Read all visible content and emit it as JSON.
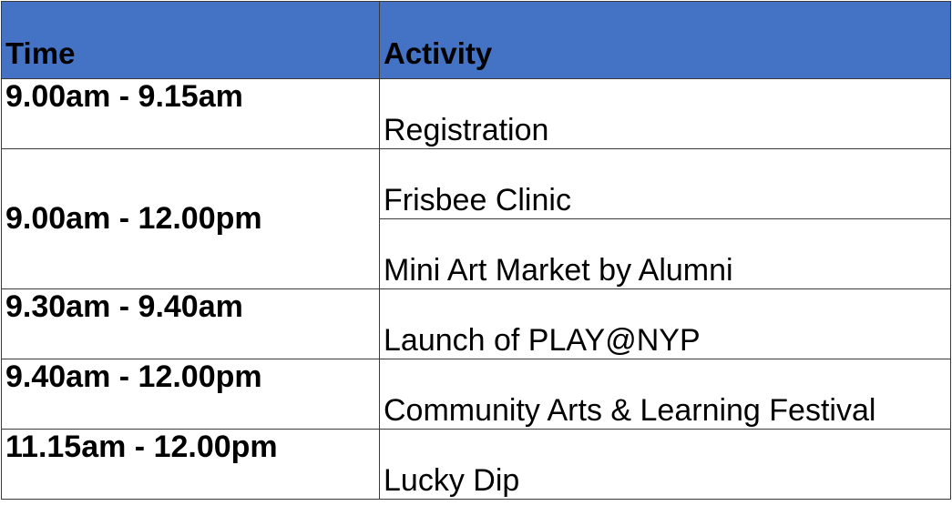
{
  "table": {
    "headers": {
      "time": "Time",
      "activity": "Activity"
    },
    "rows": [
      {
        "time": "9.00am - 9.15am",
        "activities": [
          "Registration"
        ]
      },
      {
        "time": "9.00am - 12.00pm",
        "activities": [
          "Frisbee Clinic",
          "Mini Art Market by Alumni"
        ]
      },
      {
        "time": "9.30am - 9.40am",
        "activities": [
          "Launch of PLAY@NYP"
        ]
      },
      {
        "time": "9.40am - 12.00pm",
        "activities": [
          "Community Arts & Learning Festival"
        ]
      },
      {
        "time": "11.15am - 12.00pm",
        "activities": [
          "Lucky Dip"
        ]
      }
    ]
  },
  "colors": {
    "header_background": "#4472c4",
    "border": "#3a3a3a",
    "text": "#000000"
  }
}
